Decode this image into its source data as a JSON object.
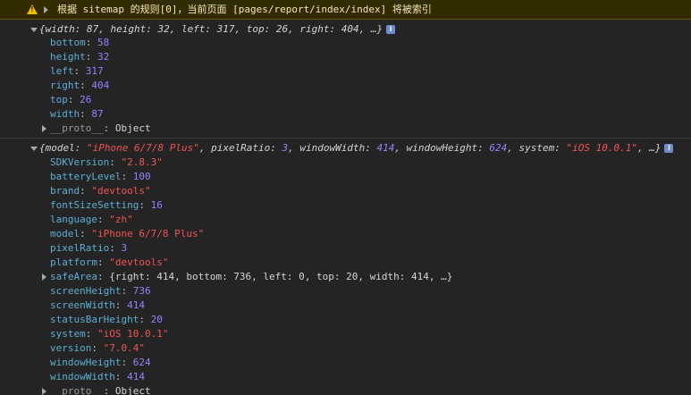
{
  "warning": {
    "text": "根据 sitemap 的规则[0]，当前页面 [pages/report/index/index] 将被索引",
    "icon": "warning-icon"
  },
  "rect": {
    "summary": "{width: 87, height: 32, left: 317, top: 26, right: 404, …}",
    "badge": "i",
    "props": [
      {
        "key": "bottom",
        "value": "58",
        "type": "num"
      },
      {
        "key": "height",
        "value": "32",
        "type": "num"
      },
      {
        "key": "left",
        "value": "317",
        "type": "num"
      },
      {
        "key": "right",
        "value": "404",
        "type": "num"
      },
      {
        "key": "top",
        "value": "26",
        "type": "num"
      },
      {
        "key": "width",
        "value": "87",
        "type": "num"
      }
    ],
    "proto": {
      "key": "__proto__",
      "value": "Object"
    }
  },
  "sysinfo": {
    "summary_parts": {
      "p1": "{model: ",
      "model": "\"iPhone 6/7/8 Plus\"",
      "p2": ", pixelRatio: ",
      "pixelRatio": "3",
      "p3": ", windowWidth: ",
      "windowWidth": "414",
      "p4": ", windowHeight: ",
      "windowHeight": "624",
      "p5": ", system: ",
      "system": "\"iOS 10.0.1\"",
      "p6": ", …}"
    },
    "badge": "i",
    "props": [
      {
        "key": "SDKVersion",
        "value": "\"2.8.3\"",
        "type": "str"
      },
      {
        "key": "batteryLevel",
        "value": "100",
        "type": "num"
      },
      {
        "key": "brand",
        "value": "\"devtools\"",
        "type": "str"
      },
      {
        "key": "fontSizeSetting",
        "value": "16",
        "type": "num"
      },
      {
        "key": "language",
        "value": "\"zh\"",
        "type": "str"
      },
      {
        "key": "model",
        "value": "\"iPhone 6/7/8 Plus\"",
        "type": "str"
      },
      {
        "key": "pixelRatio",
        "value": "3",
        "type": "num"
      },
      {
        "key": "platform",
        "value": "\"devtools\"",
        "type": "str"
      }
    ],
    "safeArea": {
      "key": "safeArea",
      "value": "{right: 414, bottom: 736, left: 0, top: 20, width: 414, …}"
    },
    "props2": [
      {
        "key": "screenHeight",
        "value": "736",
        "type": "num"
      },
      {
        "key": "screenWidth",
        "value": "414",
        "type": "num"
      },
      {
        "key": "statusBarHeight",
        "value": "20",
        "type": "num"
      },
      {
        "key": "system",
        "value": "\"iOS 10.0.1\"",
        "type": "str"
      },
      {
        "key": "version",
        "value": "\"7.0.4\"",
        "type": "str"
      },
      {
        "key": "windowHeight",
        "value": "624",
        "type": "num"
      },
      {
        "key": "windowWidth",
        "value": "414",
        "type": "num"
      }
    ],
    "proto": {
      "key": "__proto__",
      "value": "Object"
    }
  }
}
